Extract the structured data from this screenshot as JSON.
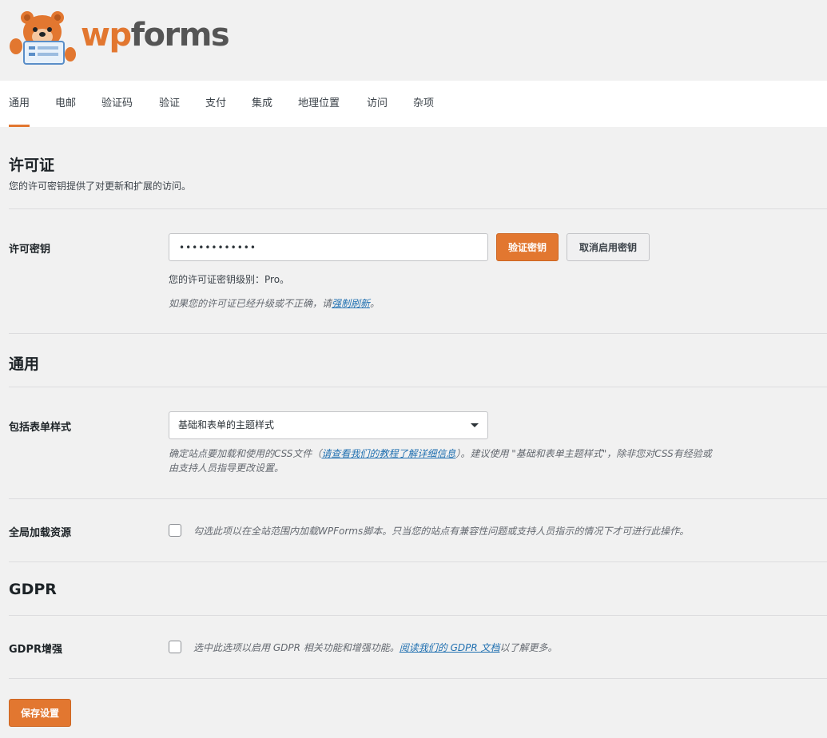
{
  "brand": {
    "wp": "wp",
    "forms": "forms",
    "accent": "#e27730"
  },
  "tabs": [
    {
      "label": "通用",
      "active": true
    },
    {
      "label": "电邮"
    },
    {
      "label": "验证码"
    },
    {
      "label": "验证"
    },
    {
      "label": "支付"
    },
    {
      "label": "集成"
    },
    {
      "label": "地理位置"
    },
    {
      "label": "访问"
    },
    {
      "label": "杂项"
    }
  ],
  "license": {
    "heading": "许可证",
    "description": "您的许可密钥提供了对更新和扩展的访问。",
    "key_label": "许可密钥",
    "key_value": "••••••••••••",
    "verify_button": "验证密钥",
    "deactivate_button": "取消启用密钥",
    "level_text": "您的许可证密钥级别：Pro。",
    "refresh_prefix": "如果您的许可证已经升级或不正确，请",
    "refresh_link": "强制刷新",
    "refresh_suffix": "。"
  },
  "general": {
    "heading": "通用",
    "style_label": "包括表单样式",
    "style_selected": "基础和表单的主题样式",
    "style_help_prefix": "确定站点要加载和使用的CSS文件（",
    "style_help_link": "请查看我们的教程了解详细信息",
    "style_help_middle": "）。建议使用 \"基础和表单主题样式\"，除非您对CSS有经验或",
    "style_help_line2": "由支持人员指导更改设置。",
    "assets_label": "全局加载资源",
    "assets_help": "勾选此项以在全站范围内加载WPForms脚本。只当您的站点有兼容性问题或支持人员指示的情况下才可进行此操作。"
  },
  "gdpr": {
    "heading": "GDPR",
    "enhance_label": "GDPR增强",
    "help_prefix": "选中此选项以启用 GDPR 相关功能和增强功能。",
    "help_link": "阅读我们的 GDPR 文档",
    "help_suffix": "以了解更多。"
  },
  "save_button": "保存设置"
}
